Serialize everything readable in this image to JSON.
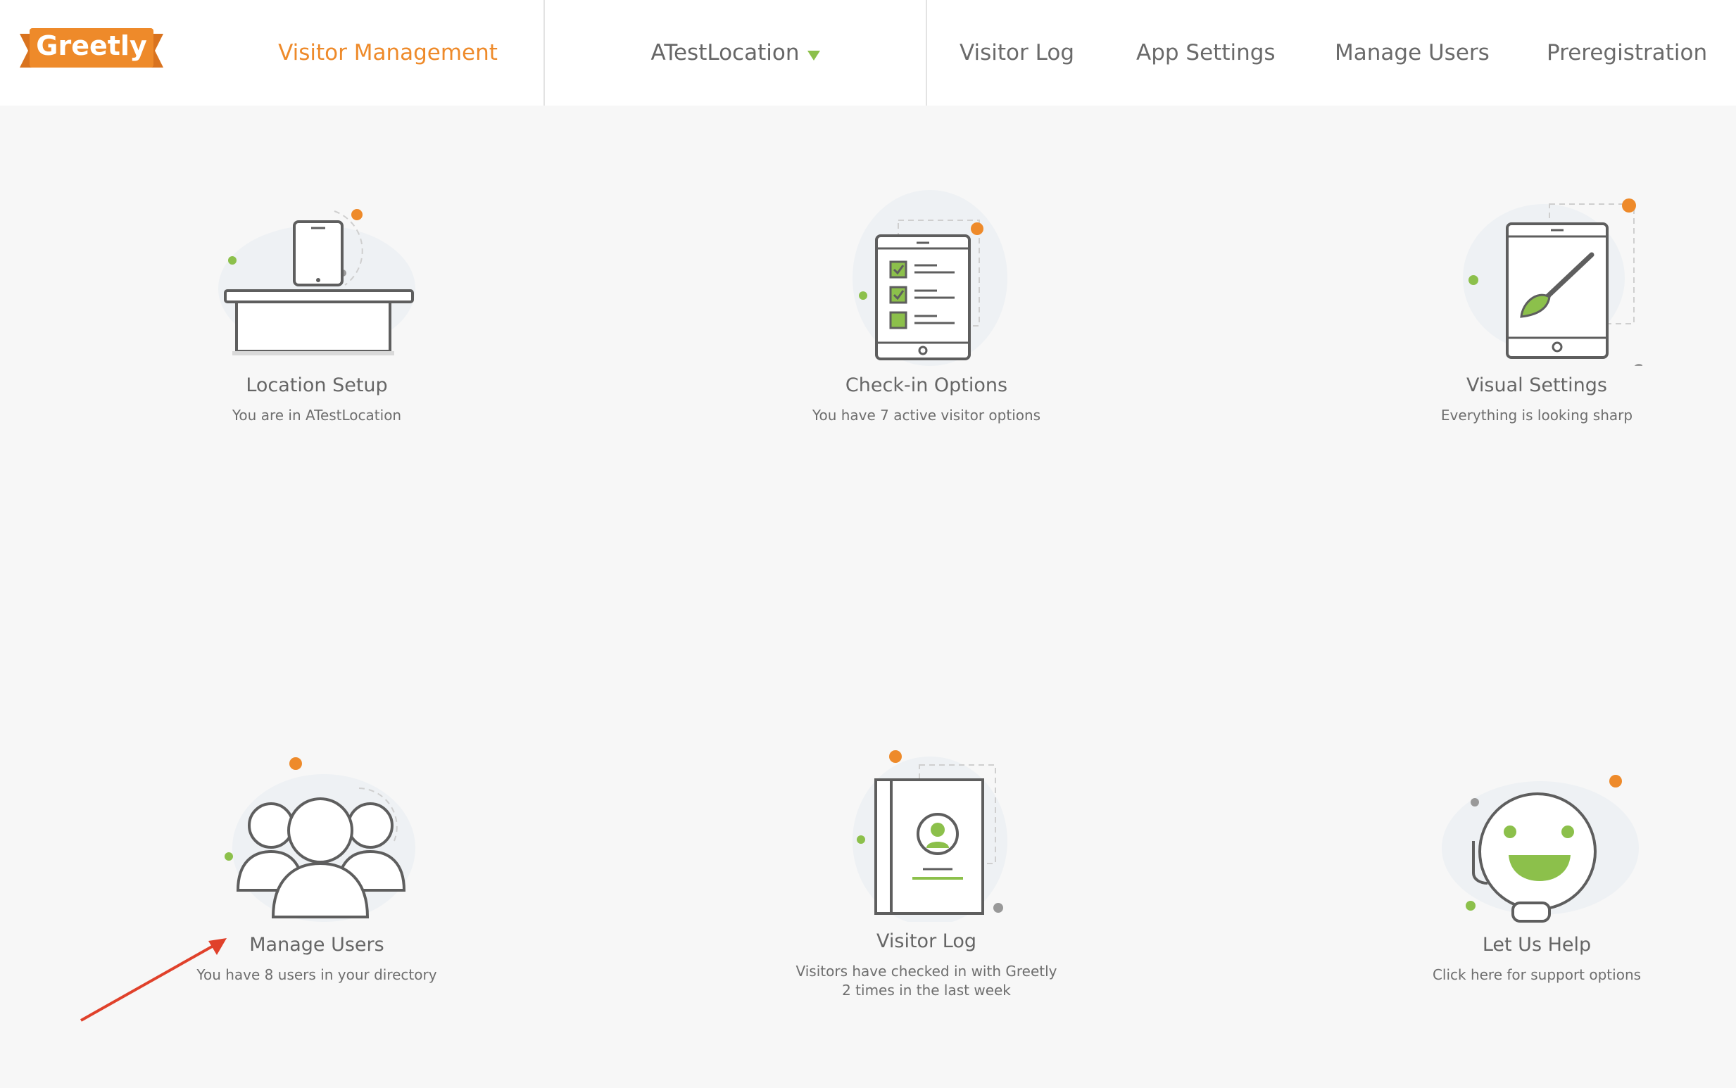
{
  "header": {
    "logo_text": "Greetly",
    "nav_main": "Visitor Management",
    "location": "ATestLocation",
    "links": [
      "Visitor Log",
      "App Settings",
      "Manage Users",
      "Preregistration"
    ]
  },
  "cards": [
    {
      "title": "Location Setup",
      "subtitle": "You are in ATestLocation",
      "icon": "desk-tablet-icon"
    },
    {
      "title": "Check-in Options",
      "subtitle": "You have 7 active visitor options",
      "icon": "checklist-tablet-icon"
    },
    {
      "title": "Visual Settings",
      "subtitle": "Everything is looking sharp",
      "icon": "paintbrush-tablet-icon"
    },
    {
      "title": "Manage Users",
      "subtitle": "You have 8 users in your directory",
      "icon": "users-group-icon"
    },
    {
      "title": "Visitor Log",
      "subtitle_line1": "Visitors have checked in with Greetly",
      "subtitle_line2": "2 times in the last week",
      "icon": "visitor-book-icon"
    },
    {
      "title": "Let Us Help",
      "subtitle": "Click here for support options",
      "icon": "smiley-headset-icon"
    }
  ],
  "colors": {
    "brand_orange": "#ee8a2a",
    "accent_green": "#8cc04b",
    "annotation_red": "#e0412b"
  }
}
